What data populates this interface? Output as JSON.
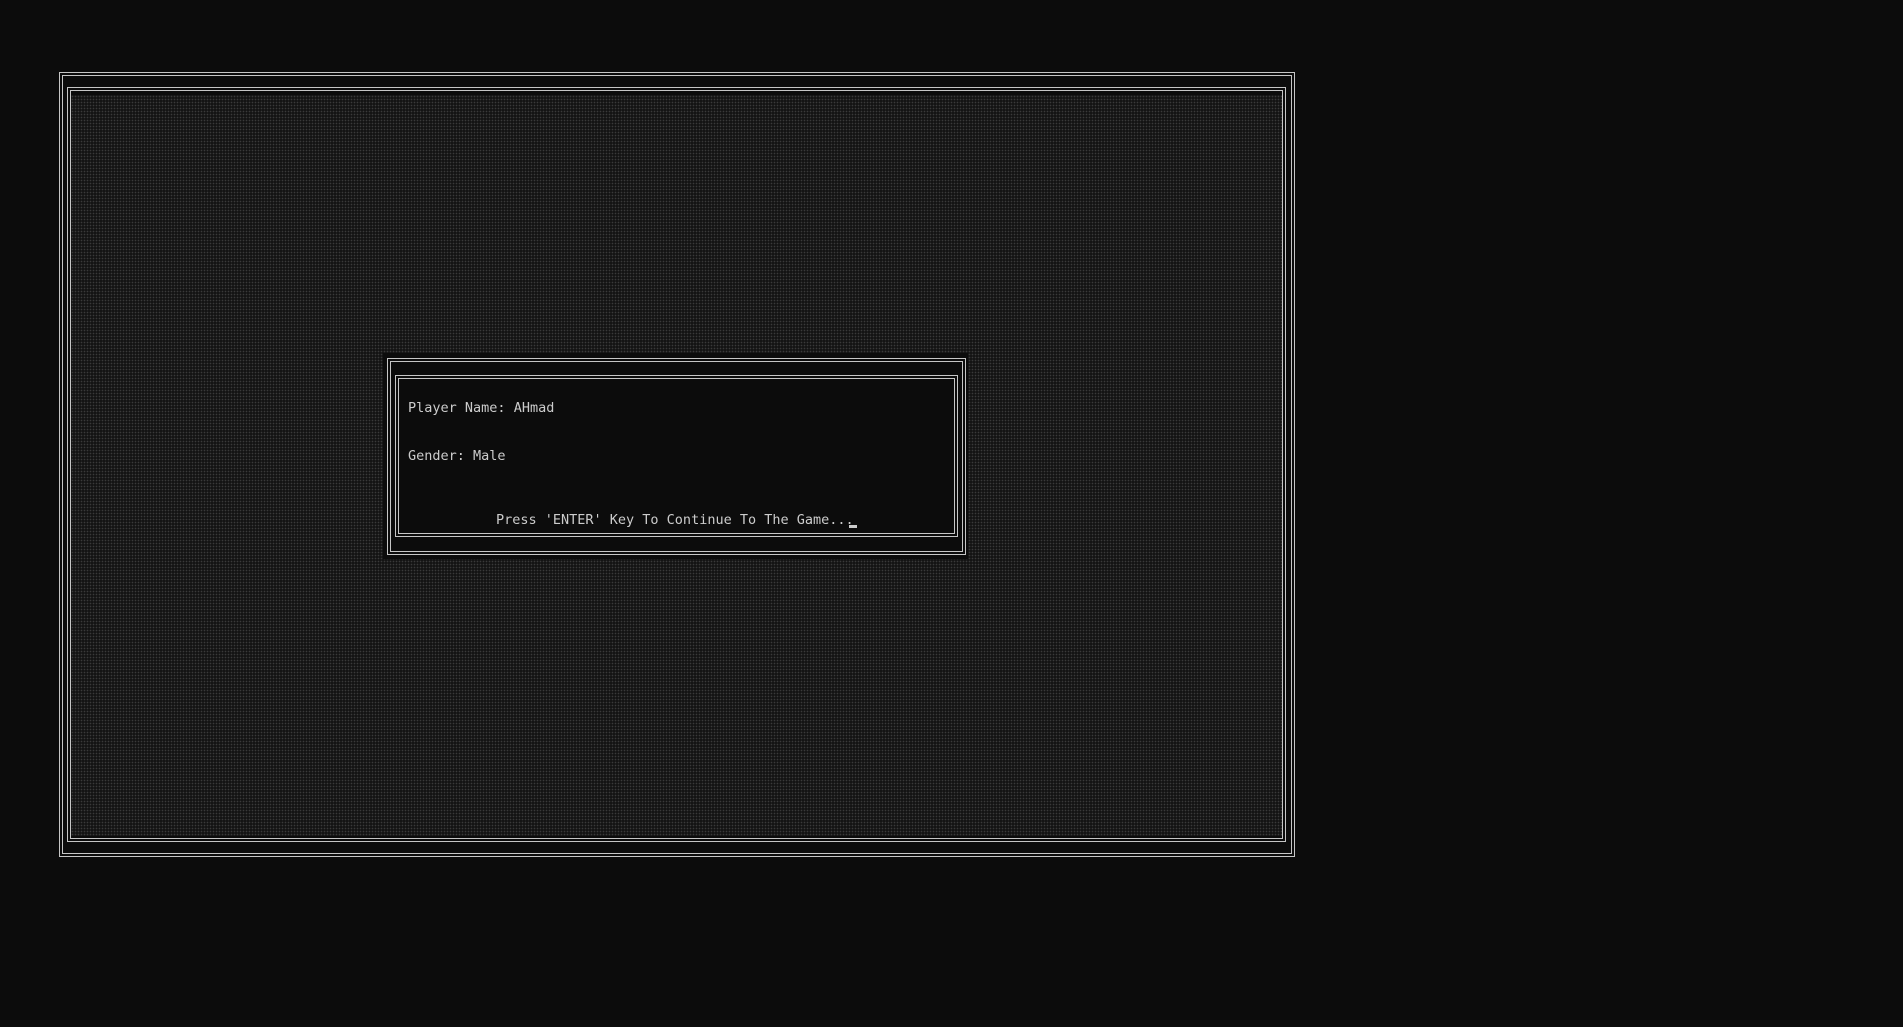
{
  "player": {
    "name_label": "Player Name:",
    "name_value": "AHmad",
    "gender_label": "Gender:",
    "gender_value": "Male"
  },
  "prompt": {
    "text": "Press 'ENTER' Key To Continue To The Game..."
  },
  "colors": {
    "background": "#0c0c0c",
    "text": "#cccccc",
    "border": "#c6c6c6"
  },
  "icons": {
    "cursor": "text-cursor-underscore"
  }
}
